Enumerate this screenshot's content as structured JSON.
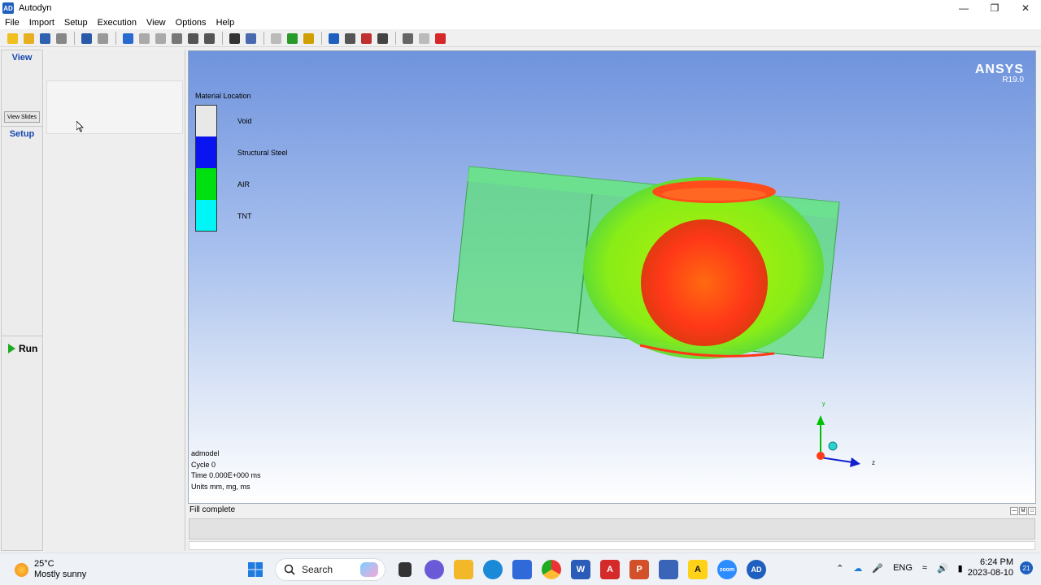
{
  "window": {
    "title": "Autodyn",
    "logo": "AD"
  },
  "menu": [
    "File",
    "Import",
    "Setup",
    "Execution",
    "View",
    "Options",
    "Help"
  ],
  "toolbar": {
    "groups": [
      [
        {
          "icon": "new-folder-icon",
          "color": "#f0c020"
        },
        {
          "icon": "open-folder-icon",
          "color": "#e8b020"
        },
        {
          "icon": "save-icon",
          "color": "#3060b0"
        },
        {
          "icon": "print-icon",
          "color": "#888888"
        }
      ],
      [
        {
          "icon": "globe-icon",
          "color": "#2a5aa8"
        },
        {
          "icon": "lightbulb-icon",
          "color": "#999999"
        }
      ],
      [
        {
          "icon": "rotate-icon",
          "color": "#2a6ad0"
        },
        {
          "icon": "pan-icon",
          "color": "#aaaaaa"
        },
        {
          "icon": "zoom-icon",
          "color": "#aaaaaa"
        },
        {
          "icon": "axes-icon",
          "color": "#777777"
        },
        {
          "icon": "fit-icon",
          "color": "#555555"
        },
        {
          "icon": "zoom-box-icon",
          "color": "#555555"
        }
      ],
      [
        {
          "icon": "eye-icon",
          "color": "#333333"
        },
        {
          "icon": "graph-icon",
          "color": "#4a6ab0"
        }
      ],
      [
        {
          "icon": "hand-icon",
          "color": "#bbbbbb"
        },
        {
          "icon": "cube-icon",
          "color": "#2a9a2a"
        },
        {
          "icon": "lightning-icon",
          "color": "#d0a000"
        }
      ],
      [
        {
          "icon": "slide-icon",
          "color": "#1f5fbf"
        },
        {
          "icon": "camera-icon",
          "color": "#555555"
        },
        {
          "icon": "movie-icon",
          "color": "#c03030"
        },
        {
          "icon": "text-icon",
          "color": "#444444"
        }
      ],
      [
        {
          "icon": "window-icon",
          "color": "#666666"
        },
        {
          "icon": "recycle-icon",
          "color": "#bbbbbb"
        },
        {
          "icon": "close-red-icon",
          "color": "#d62828"
        }
      ]
    ]
  },
  "nav": {
    "view": "View",
    "view_slides": "View Slides",
    "setup": "Setup",
    "run": "Run"
  },
  "viewport": {
    "brand_main": "ANSYS",
    "brand_sub": "R19.0",
    "legend": {
      "title": "Material Location",
      "items": [
        {
          "label": "Void",
          "color": "#e8e8e8"
        },
        {
          "label": "Structural Steel",
          "color": "#0a14f0"
        },
        {
          "label": "AIR",
          "color": "#00e010"
        },
        {
          "label": "TNT",
          "color": "#00f6f6"
        }
      ]
    },
    "info": [
      "admodel",
      "Cycle 0",
      "Time 0.000E+000 ms",
      "Units mm, mg, ms"
    ],
    "axis_y": "y",
    "axis_z": "z"
  },
  "status": {
    "text": "Fill complete"
  },
  "taskbar": {
    "temperature": "25°C",
    "weather": "Mostly sunny",
    "search_placeholder": "Search",
    "lang": "ENG",
    "time": "6:24 PM",
    "date": "2023-08-10",
    "notifications": "21"
  }
}
